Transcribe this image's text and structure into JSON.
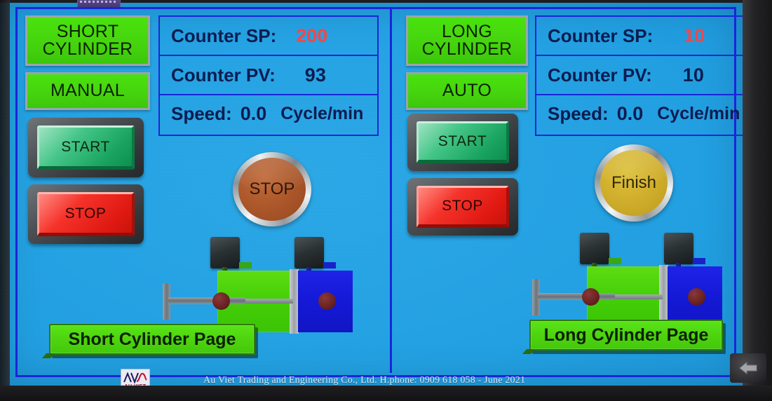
{
  "device": {
    "top_chip_name": "status-strip",
    "hw_back_button": "back-arrow"
  },
  "left_panel": {
    "title": "SHORT\nCYLINDER",
    "title_line1": "SHORT",
    "title_line2": "CYLINDER",
    "mode": "MANUAL",
    "counters": [
      {
        "label": "Counter SP:",
        "value": "200",
        "kind": "sp"
      },
      {
        "label": "Counter PV:",
        "value": "93",
        "kind": "pv"
      }
    ],
    "speed": {
      "label": "Speed:",
      "value": "0.0",
      "unit": "Cycle/min"
    },
    "start_button": "START",
    "stop_button": "STOP",
    "lamp": {
      "label": "STOP",
      "color": "#a8532a"
    },
    "nav_button": "Short Cylinder Page"
  },
  "right_panel": {
    "title_line1": "LONG",
    "title_line2": "CYLINDER",
    "mode": "AUTO",
    "counters": [
      {
        "label": "Counter SP:",
        "value": "10",
        "kind": "sp"
      },
      {
        "label": "Counter PV:",
        "value": "10",
        "kind": "pv"
      }
    ],
    "speed": {
      "label": "Speed:",
      "value": "0.0",
      "unit": "Cycle/min"
    },
    "start_button": "START",
    "stop_button": "STOP",
    "lamp": {
      "label": "Finish",
      "color": "#d2b02e"
    },
    "nav_button": "Long Cylinder Page"
  },
  "footer": {
    "logo_text": "AU VIET",
    "credit": "Au Viet Trading and Engineering Co., Ltd. H.phone: 0909 618 058 - June 2021"
  },
  "colors": {
    "screen_blue": "#1f9fe2",
    "frame_blue": "#1a26d8",
    "plate_green": "#46d40e",
    "value_red": "#f2474a",
    "label_navy": "#0d1c4f"
  }
}
